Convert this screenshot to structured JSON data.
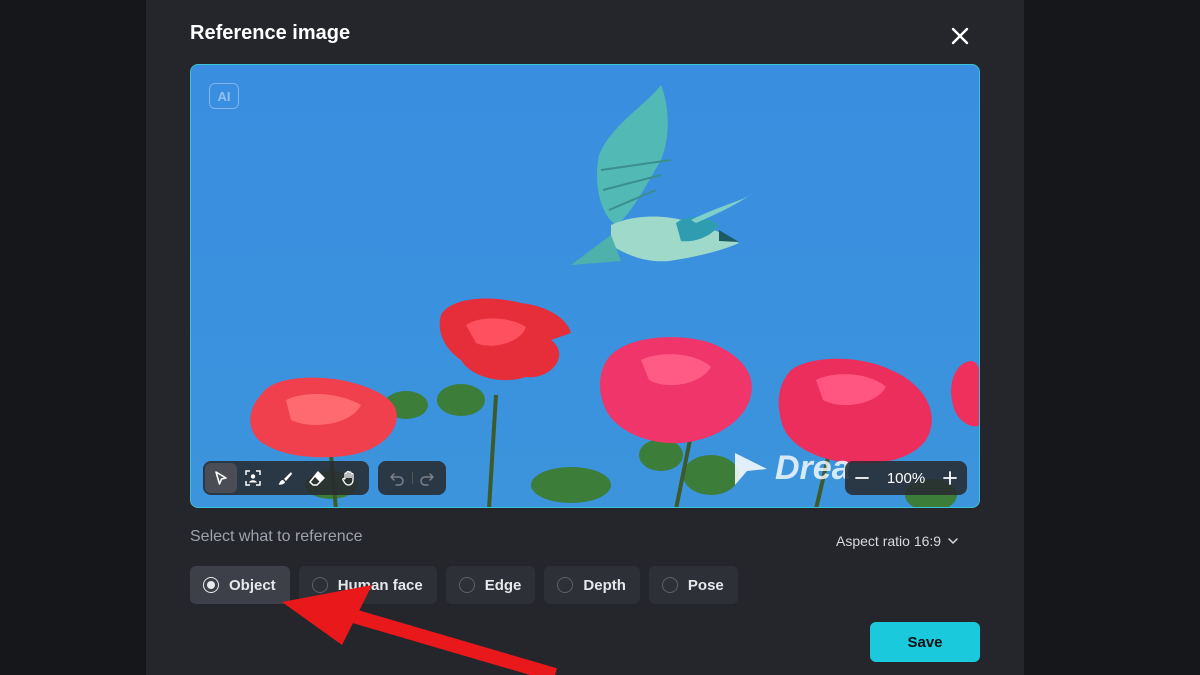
{
  "modal": {
    "title": "Reference image"
  },
  "canvas": {
    "ai_badge": "AI",
    "watermark_text": "Drea",
    "toolbar": {
      "tools": [
        "select-icon",
        "face-select-icon",
        "brush-icon",
        "eraser-icon",
        "hand-icon"
      ],
      "active_tool": "select-icon"
    },
    "history": [
      "undo-icon",
      "redo-icon"
    ],
    "zoom": {
      "value": "100%"
    }
  },
  "reference": {
    "label": "Select what to reference",
    "aspect_ratio_label": "Aspect ratio 16:9",
    "options": [
      "Object",
      "Human face",
      "Edge",
      "Depth",
      "Pose"
    ],
    "selected": "Object"
  },
  "actions": {
    "save_label": "Save"
  },
  "colors": {
    "accent": "#1bc9dc",
    "modal_bg": "#24262c",
    "annotation_arrow": "#e8181b"
  }
}
